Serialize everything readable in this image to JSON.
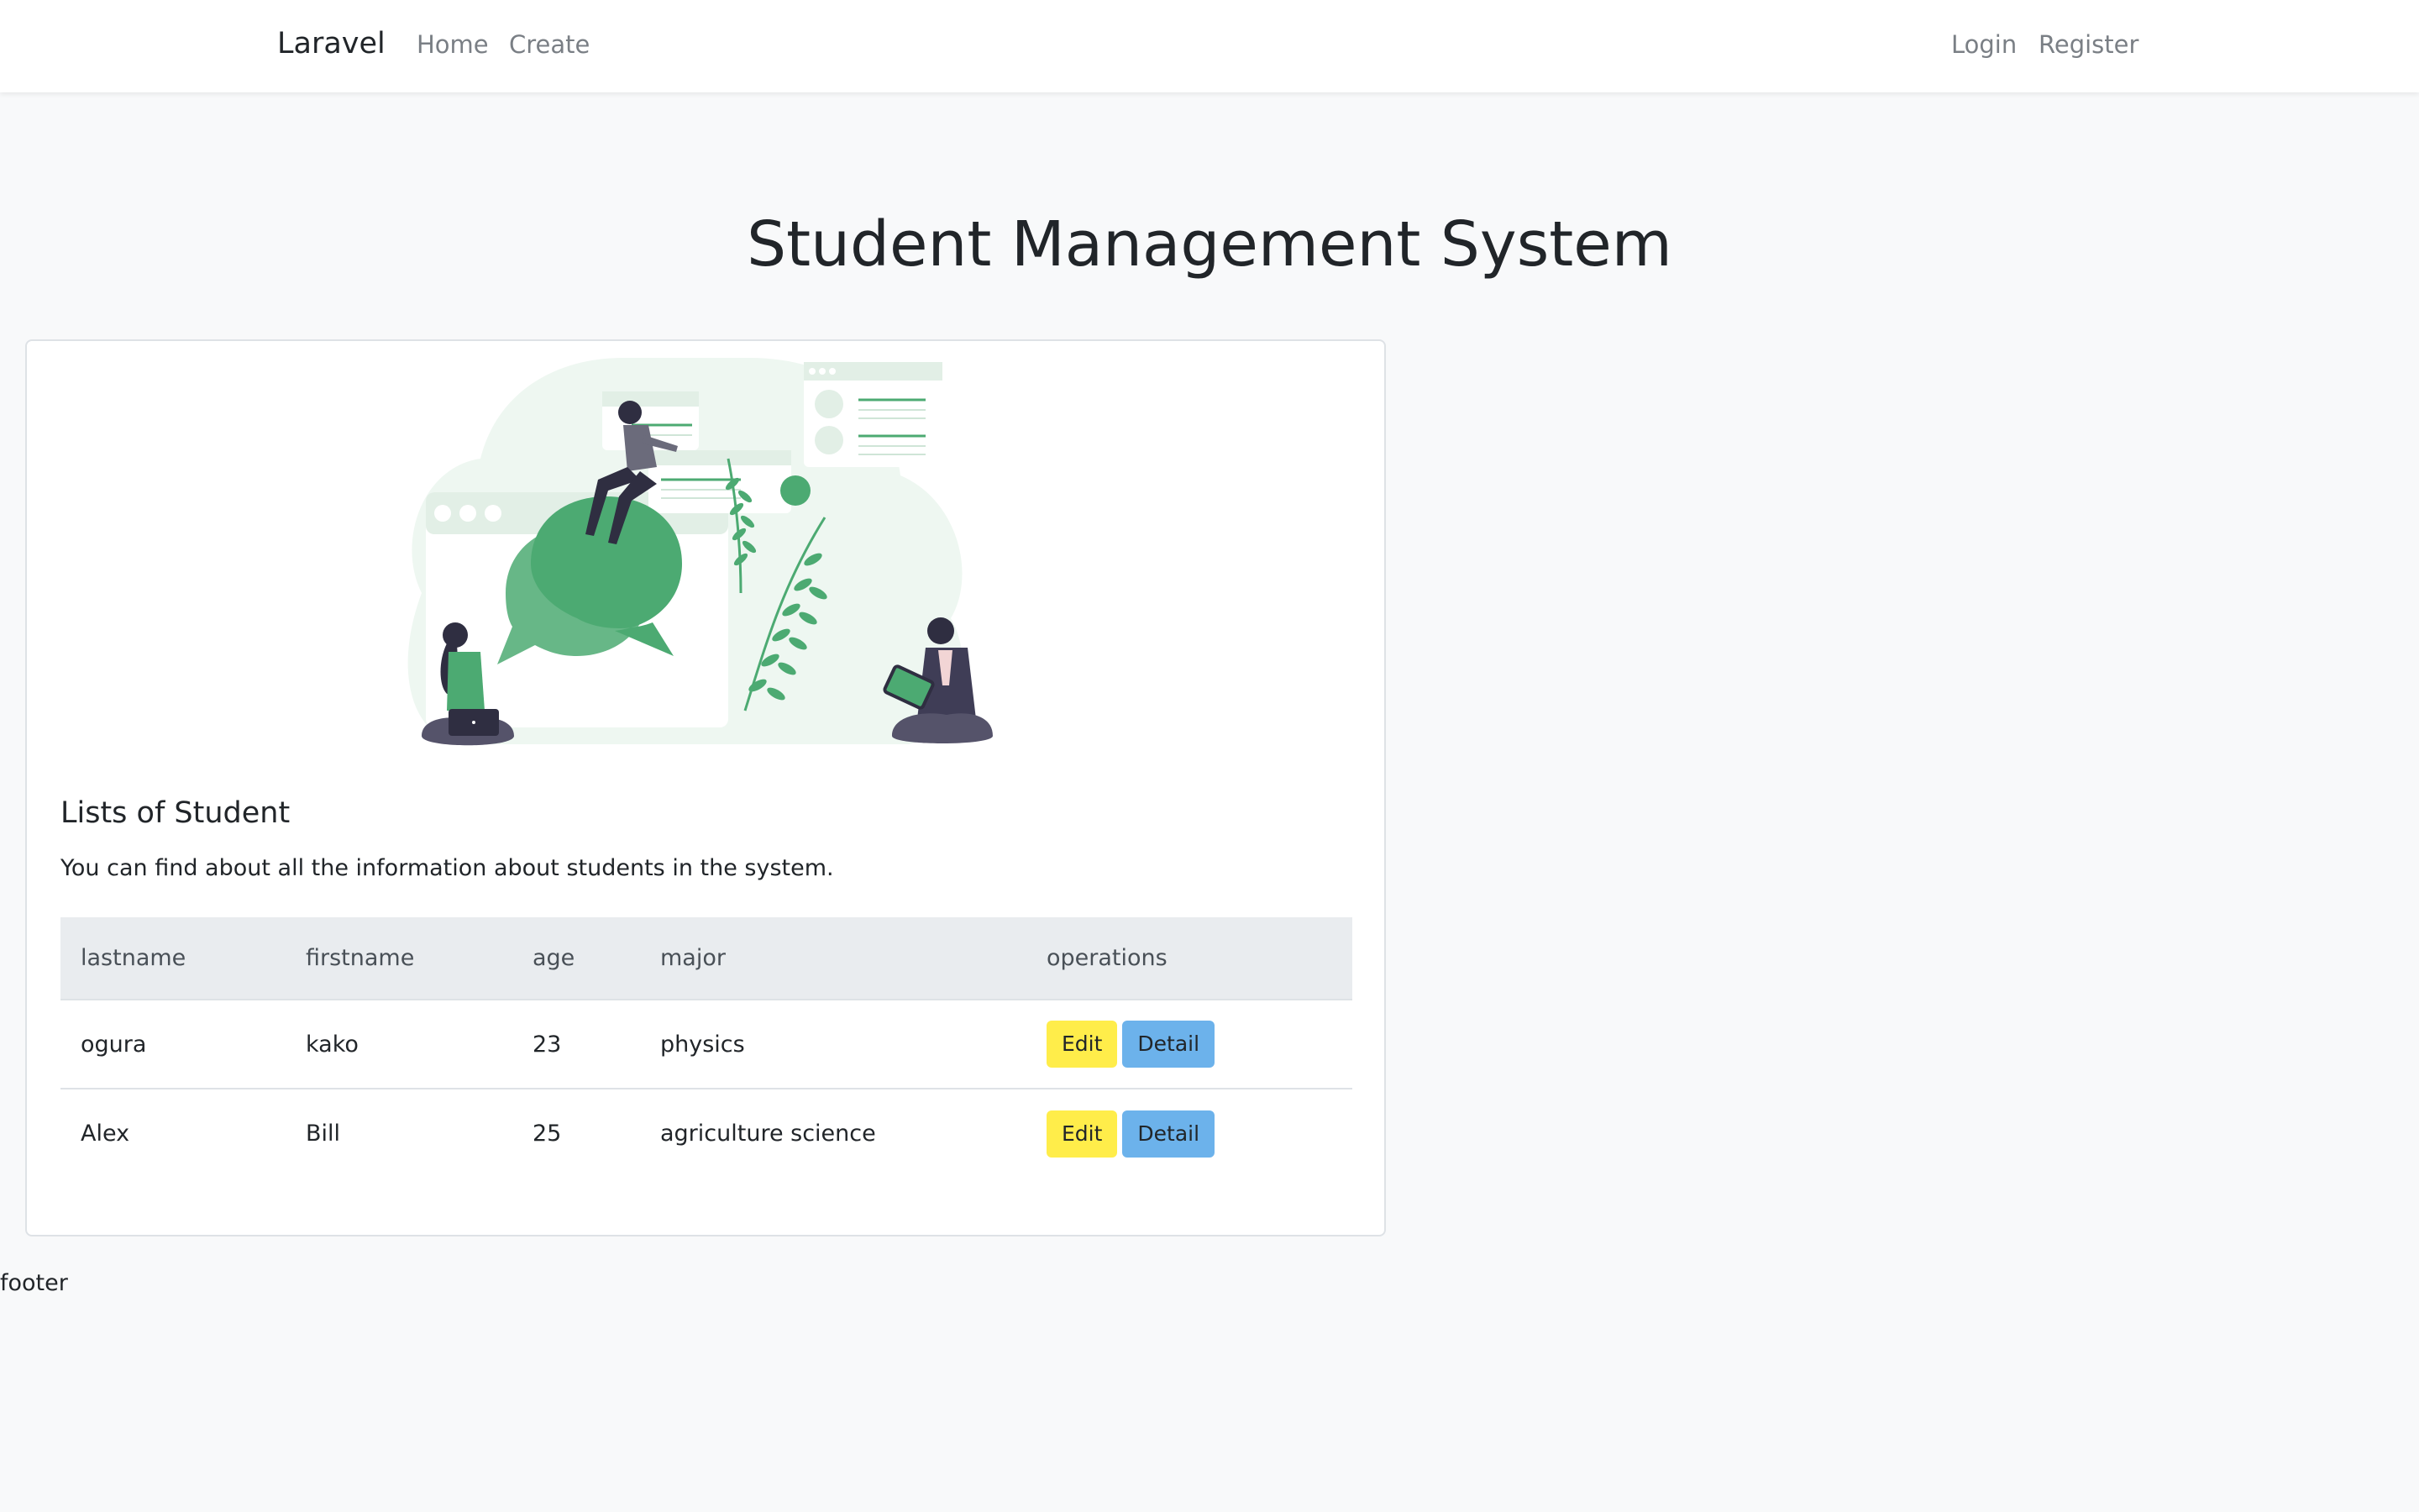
{
  "navbar": {
    "brand": "Laravel",
    "left_links": [
      "Home",
      "Create"
    ],
    "right_links": [
      "Login",
      "Register"
    ]
  },
  "page": {
    "title": "Student Management System"
  },
  "card": {
    "illustration": "people-chatting-illustration",
    "title": "Lists of Student",
    "description": "You can find about all the information about students in the system."
  },
  "table": {
    "headers": [
      "lastname",
      "firstname",
      "age",
      "major",
      "operations"
    ],
    "rows": [
      {
        "lastname": "ogura",
        "firstname": "kako",
        "age": "23",
        "major": "physics"
      },
      {
        "lastname": "Alex",
        "firstname": "Bill",
        "age": "25",
        "major": "agriculture science"
      }
    ],
    "edit_label": "Edit",
    "detail_label": "Detail"
  },
  "footer": {
    "text": "footer"
  },
  "colors": {
    "accent_green": "#4caa72",
    "edit_button": "#ffed4a",
    "detail_button": "#6cb2eb",
    "page_background": "#f8f9fa"
  }
}
